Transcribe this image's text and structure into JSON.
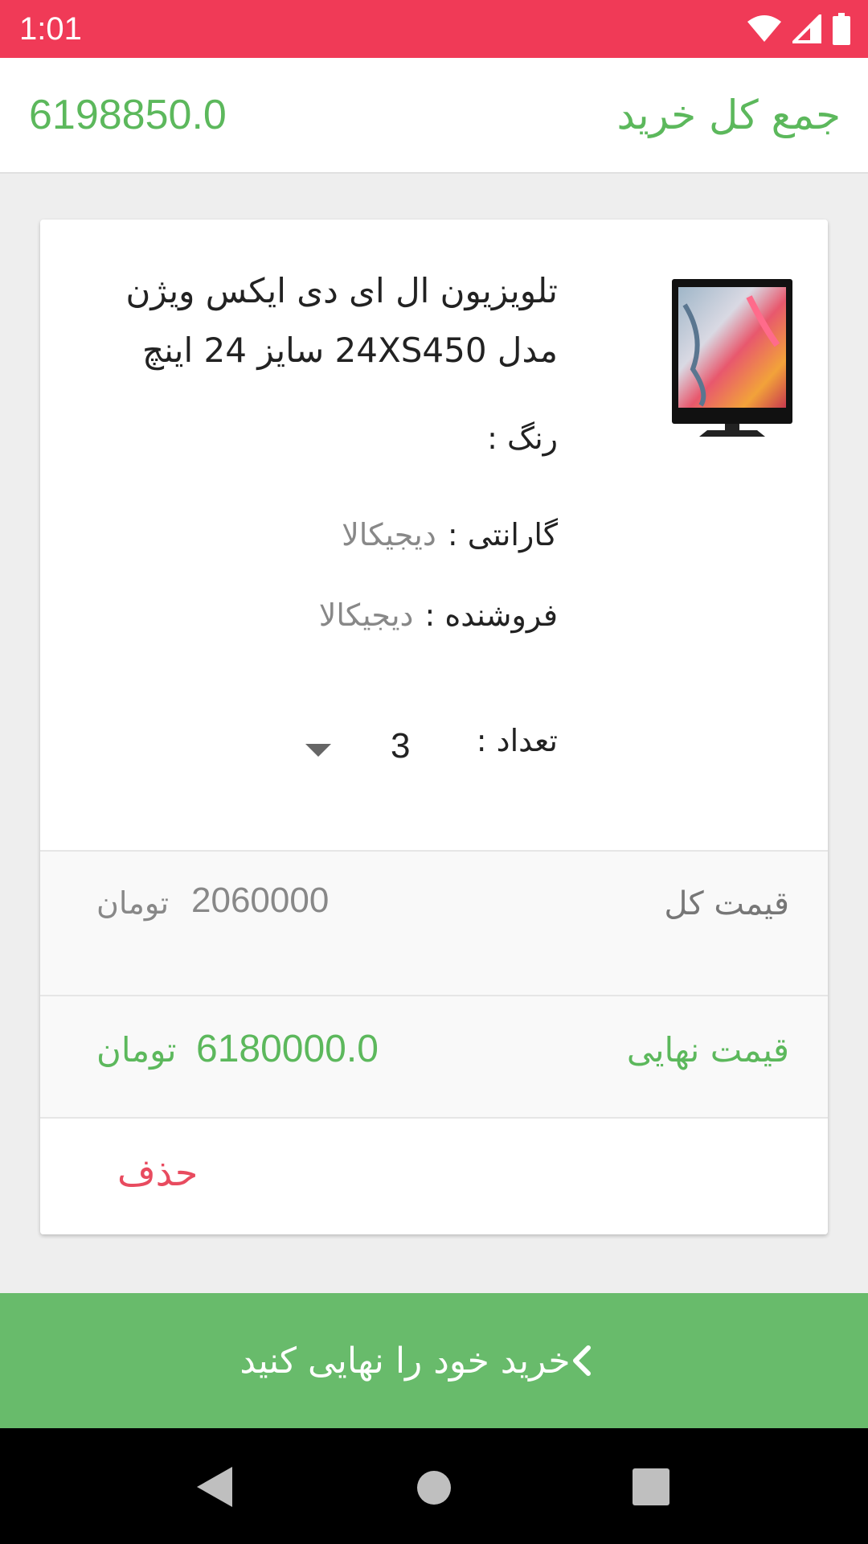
{
  "status_bar": {
    "time": "1:01",
    "icons": [
      "wifi-icon",
      "cellular-signal-icon",
      "battery-icon"
    ]
  },
  "summary": {
    "title": "جمع کل خرید",
    "total": "6198850.0"
  },
  "cart_item": {
    "name": "تلویزیون ال ای دی ایکس ویژن مدل 24XS450 سایز 24 اینچ",
    "image_icon": "tv-product-image",
    "color_label": "رنگ :",
    "color_value": "",
    "warranty_label": "گارانتی :",
    "warranty_value": "دیجیکالا",
    "seller_label": "فروشنده :",
    "seller_value": "دیجیکالا",
    "quantity_label": "تعداد :",
    "quantity_value": "3",
    "total_price_label": "قیمت کل",
    "total_price_value": "2060000",
    "total_price_currency": "تومان",
    "final_price_label": "قیمت نهایی",
    "final_price_value": "6180000.0",
    "final_price_currency": "تومان",
    "delete_label": "حذف"
  },
  "checkout": {
    "label": "خرید خود را نهایی کنید",
    "icon": "chevron-left-icon"
  },
  "nav_bar": {
    "icons": [
      "back-icon",
      "home-icon",
      "recents-icon"
    ]
  },
  "colors": {
    "status_bar": "#f03a57",
    "accent_green": "#5cb85c",
    "checkout_green": "#68bb6b",
    "delete_red": "#e84b5f"
  }
}
